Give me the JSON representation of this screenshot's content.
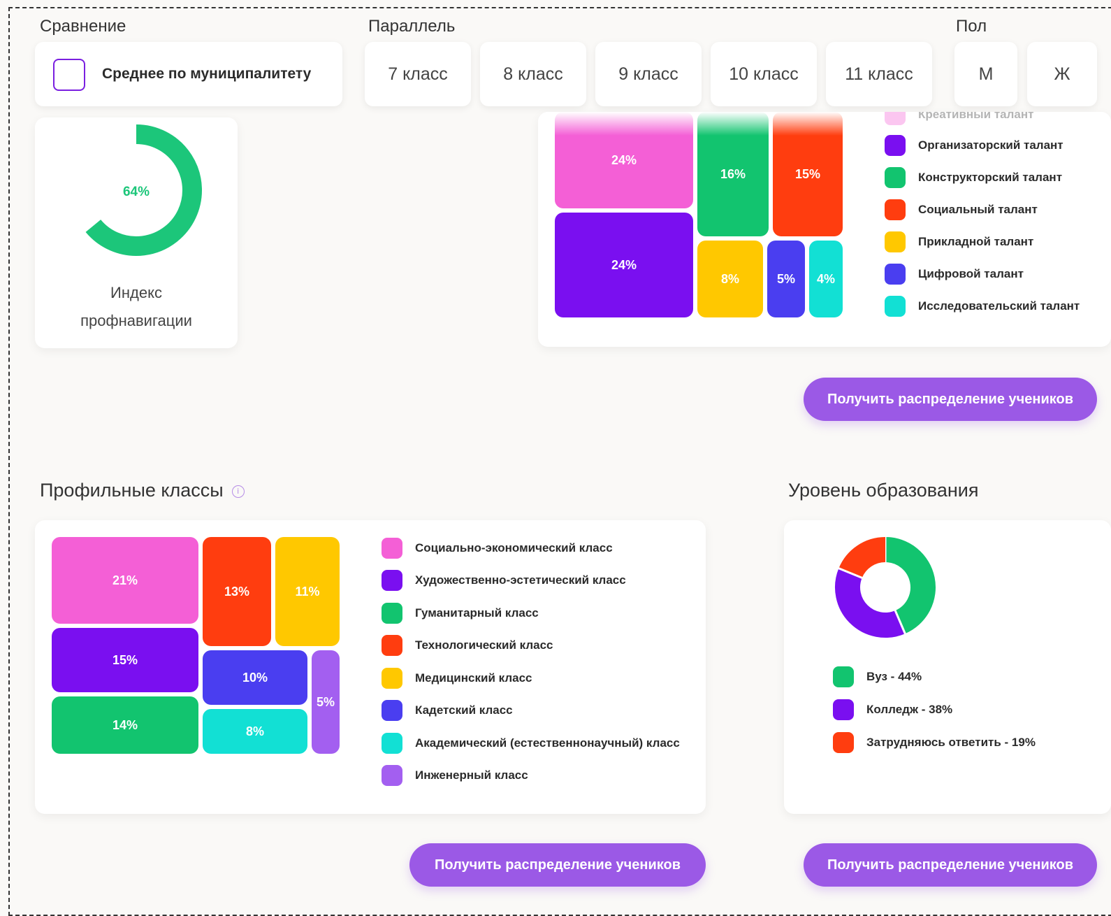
{
  "filters": {
    "comparison_label": "Сравнение",
    "comparison_option": "Среднее по муниципалитету",
    "parallel_label": "Параллель",
    "grades": [
      "7 класс",
      "8 класс",
      "9 класс",
      "10 класс",
      "11 класс"
    ],
    "gender_label": "Пол",
    "genders": [
      "М",
      "Ж"
    ]
  },
  "index_card": {
    "value": "64%",
    "caption_line1": "Индекс",
    "caption_line2": "профнавигации",
    "percent": 64,
    "color": "#1cc67a"
  },
  "talents": {
    "cut_label": "Креативный талант",
    "tiles": [
      {
        "label": "24%",
        "color": "#f45fd6"
      },
      {
        "label": "24%",
        "color": "#7a0ff0"
      },
      {
        "label": "16%",
        "color": "#12c46f"
      },
      {
        "label": "15%",
        "color": "#ff3d0f"
      },
      {
        "label": "8%",
        "color": "#ffc800"
      },
      {
        "label": "5%",
        "color": "#4a3ef0"
      },
      {
        "label": "4%",
        "color": "#12e0d4"
      }
    ],
    "legend": [
      {
        "label": "Организаторский талант",
        "color": "#7a0ff0"
      },
      {
        "label": "Конструкторский талант",
        "color": "#12c46f"
      },
      {
        "label": "Социальный талант",
        "color": "#ff3d0f"
      },
      {
        "label": "Прикладной талант",
        "color": "#ffc800"
      },
      {
        "label": "Цифровой талант",
        "color": "#4a3ef0"
      },
      {
        "label": "Исследовательский талант",
        "color": "#12e0d4"
      }
    ],
    "button": "Получить распределение учеников"
  },
  "profile_classes": {
    "title": "Профильные классы",
    "info_icon": "i",
    "tiles": [
      {
        "label": "21%",
        "color": "#f45fd6"
      },
      {
        "label": "15%",
        "color": "#7a0ff0"
      },
      {
        "label": "14%",
        "color": "#12c46f"
      },
      {
        "label": "13%",
        "color": "#ff3d0f"
      },
      {
        "label": "11%",
        "color": "#ffc800"
      },
      {
        "label": "10%",
        "color": "#4a3ef0"
      },
      {
        "label": "8%",
        "color": "#12e0d4"
      },
      {
        "label": "5%",
        "color": "#a35ff0"
      }
    ],
    "legend": [
      {
        "label": "Социально-экономический класс",
        "color": "#f45fd6"
      },
      {
        "label": "Художественно-эстетический класс",
        "color": "#7a0ff0"
      },
      {
        "label": "Гуманитарный класс",
        "color": "#12c46f"
      },
      {
        "label": "Технологический класс",
        "color": "#ff3d0f"
      },
      {
        "label": "Медицинский класс",
        "color": "#ffc800"
      },
      {
        "label": "Кадетский класс",
        "color": "#4a3ef0"
      },
      {
        "label": "Академический (естественнонаучный) класс",
        "color": "#12e0d4"
      },
      {
        "label": "Инженерный класс",
        "color": "#a35ff0"
      }
    ],
    "button": "Получить распределение учеников"
  },
  "education": {
    "title": "Уровень образования",
    "legend": [
      {
        "label": "Вуз - 44%",
        "color": "#12c46f"
      },
      {
        "label": "Колледж - 38%",
        "color": "#7a0ff0"
      },
      {
        "label": "Затрудняюсь ответить - 19%",
        "color": "#ff3d0f"
      }
    ],
    "button": "Получить распределение учеников"
  },
  "chart_data": [
    {
      "type": "treemap",
      "categories": [
        "",
        "Организаторский талант",
        "Конструкторский талант",
        "Социальный талант",
        "Прикладной талант",
        "Цифровой талант",
        "Исследовательский талант"
      ],
      "values": [
        24,
        24,
        16,
        15,
        8,
        5,
        4
      ]
    },
    {
      "type": "treemap",
      "categories": [
        "Социально-экономический класс",
        "Художественно-эстетический класс",
        "Гуманитарный класс",
        "Технологический класс",
        "Медицинский класс",
        "Кадетский класс",
        "Академический (естественнонаучный) класс",
        "Инженерный класс"
      ],
      "values": [
        21,
        15,
        14,
        13,
        11,
        10,
        8,
        5
      ]
    },
    {
      "type": "pie",
      "categories": [
        "Вуз",
        "Колледж",
        "Затрудняюсь ответить"
      ],
      "values": [
        44,
        38,
        19
      ],
      "colors": [
        "#12c46f",
        "#7a0ff0",
        "#ff3d0f"
      ]
    },
    {
      "type": "pie",
      "values": [
        64
      ],
      "colors": [
        "#1cc67a"
      ]
    }
  ]
}
